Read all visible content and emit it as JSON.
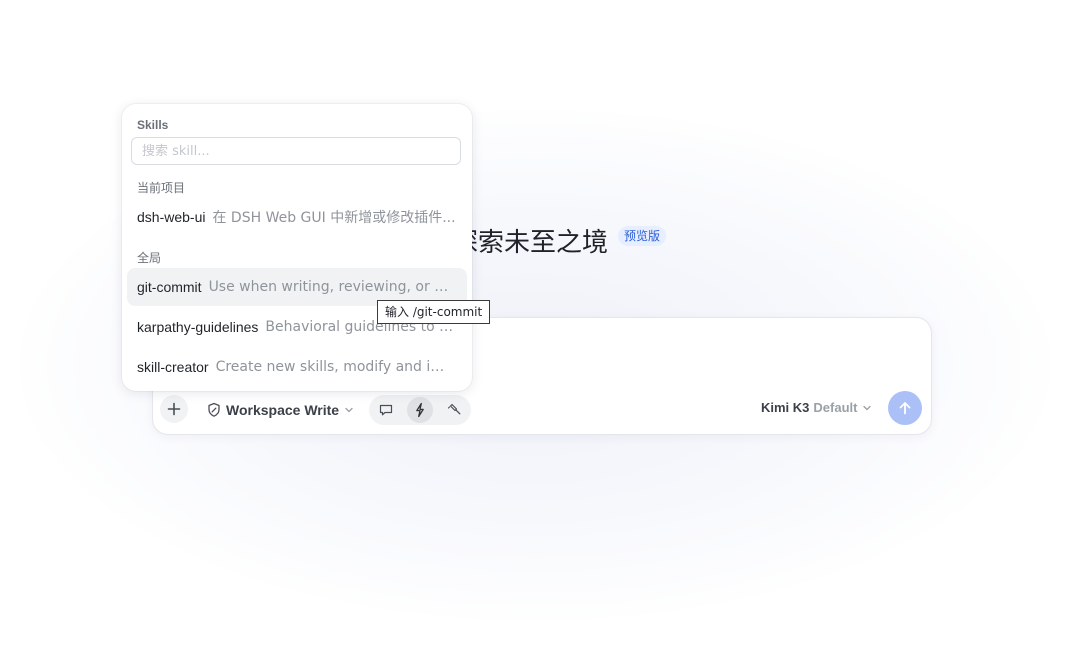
{
  "hero": {
    "title": "探索未至之境",
    "badge": "预览版"
  },
  "skills_panel": {
    "title": "Skills",
    "search_placeholder": "搜索 skill...",
    "search_value": "",
    "sections": [
      {
        "label": "当前项目",
        "items": [
          {
            "name": "dsh-web-ui",
            "description": "在 DSH Web GUI 中新增或修改插件..."
          }
        ]
      },
      {
        "label": "全局",
        "items": [
          {
            "name": "git-commit",
            "description": "Use when writing, reviewing, or fixing..."
          },
          {
            "name": "karpathy-guidelines",
            "description": "Behavioral guidelines to red..."
          },
          {
            "name": "skill-creator",
            "description": "Create new skills, modify and improv..."
          }
        ]
      }
    ],
    "hovered_item": "git-commit"
  },
  "tooltip": {
    "text": "输入 /git-commit"
  },
  "composer": {
    "placeholder": "",
    "add_icon": "plus-icon",
    "workspace": {
      "icon": "shield-edit-icon",
      "label": "Workspace Write",
      "caret_icon": "chevron-down-icon"
    },
    "modes": [
      {
        "icon": "chat-bubble-icon",
        "active": false
      },
      {
        "icon": "lightning-icon",
        "active": true
      },
      {
        "icon": "hammer-icon",
        "active": false
      }
    ],
    "model": {
      "name": "Kimi K3",
      "mode": "Default",
      "caret_icon": "chevron-down-icon"
    },
    "send_icon": "arrow-up-icon"
  },
  "colors": {
    "accent": "#aac0f7",
    "badge_text": "#2b5fd9",
    "badge_bg": "#e6eeff",
    "hover_bg": "#f1f2f4"
  }
}
